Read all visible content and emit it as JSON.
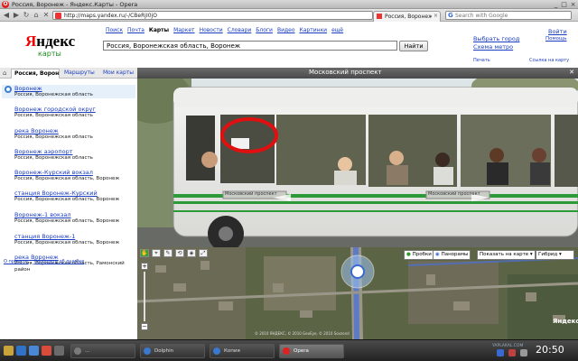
{
  "browser": {
    "window_title": "Россия, Воронеж - Яндекс.Карты - Opera",
    "url": "http://maps.yandex.ru/-/CBeRjI0jO",
    "tab_label": "Россия, Воронеж...",
    "search_placeholder": "Search with Google",
    "window_buttons": [
      "_",
      "□",
      "×"
    ]
  },
  "yandex": {
    "logo_ya": "Я",
    "logo_rest": "ндекс",
    "logo_sub": "карты",
    "nav": [
      "Поиск",
      "Почта",
      "Карты",
      "Маркет",
      "Новости",
      "Словари",
      "Блоги",
      "Видео",
      "Картинки",
      "ещё"
    ],
    "nav_active": "Карты",
    "search_value": "Россия, Воронежская область, Воронеж",
    "find_button": "Найти",
    "choose_city": "Выбрать город",
    "metro_scheme": "Схема метро",
    "enter": "Войти",
    "help": "Помощь",
    "print": "Печать",
    "map_link": "Ссылка на карту"
  },
  "left_panel": {
    "tabs": [
      "Россия, Воронеж",
      "Маршруты",
      "Мои карты"
    ],
    "results": [
      {
        "title": "Воронеж",
        "subtitle": "Россия, Воронежская область",
        "selected": true
      },
      {
        "title": "Воронеж городской округ",
        "subtitle": "Россия, Воронежская область"
      },
      {
        "title": "река Воронеж",
        "subtitle": "Россия, Воронежская область"
      },
      {
        "title": "Воронеж аэропорт",
        "subtitle": "Россия, Воронежская область"
      },
      {
        "title": "Воронеж-Курский вокзал",
        "subtitle": "Россия, Воронежская область, Воронеж"
      },
      {
        "title": "станция Воронеж-Курский",
        "subtitle": "Россия, Воронежская область, Воронеж"
      },
      {
        "title": "Воронеж-1 вокзал",
        "subtitle": "Россия, Воронежская область, Воронеж"
      },
      {
        "title": "станция Воронеж-1",
        "subtitle": "Россия, Воронежская область, Воронеж"
      },
      {
        "title": "река Воронеж",
        "subtitle": "Россия, Воронежская область, Рамонский район"
      }
    ],
    "footer_about": "О проекте",
    "footer_report": "Сообщить об ошибке"
  },
  "panorama": {
    "title": "Московский проспект",
    "bus_sign": "Московский проспект"
  },
  "map": {
    "buttons": [
      "Пробки",
      "Панорамы",
      "Показать на карте",
      "Гибрид"
    ],
    "brand": "Яндекс",
    "copyright": "© 2010 ЯНДЕКС, © 2010 GeoEye, © 2010 Sovzond"
  },
  "taskbar": {
    "items": [
      "Dolphin",
      "Копия",
      "Opera"
    ],
    "clock": "20:50",
    "watermark": "YAPLAKAL.COM"
  },
  "colors": {
    "yandex_red": "#ee0000",
    "link_blue": "#1a3dc1",
    "karty_green": "#1e8b1e"
  }
}
